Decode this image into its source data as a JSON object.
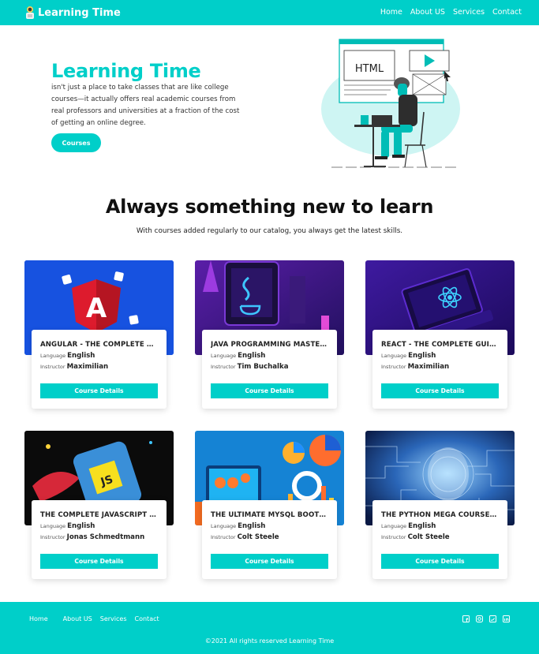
{
  "nav": {
    "brand": "Learning Time",
    "links": [
      "Home",
      "About US",
      "Services",
      "Contact"
    ]
  },
  "hero": {
    "title": "Learning Time",
    "text": "isn't just a place to take classes that are like college courses—it actually offers real academic courses from real professors and universities at a fraction of the cost of getting an online degree.",
    "button": "Courses",
    "illustration_label": "HTML"
  },
  "section": {
    "title": "Always something new to learn",
    "subtitle": "With courses added regularly to our catalog, you always get the latest skills."
  },
  "labels": {
    "language": "Language",
    "instructor": "Instructor",
    "details_button": "Course Details"
  },
  "courses": [
    {
      "name": "ANGULAR - THE COMPLETE GUI...",
      "language": "English",
      "instructor": "Maximilian",
      "image": "angular-logo"
    },
    {
      "name": "JAVA PROGRAMMING MASTERC...",
      "language": "English",
      "instructor": "Tim Buchalka",
      "image": "java-laptop"
    },
    {
      "name": "REACT - THE COMPLETE GUIDE (...",
      "language": "English",
      "instructor": "Maximilian",
      "image": "react-laptop"
    },
    {
      "name": "THE COMPLETE JAVASCRIPT CO...",
      "language": "English",
      "instructor": "Jonas Schmedtmann",
      "image": "javascript-mug"
    },
    {
      "name": "THE ULTIMATE MYSQL BOOTCA...",
      "language": "English",
      "instructor": "Colt Steele",
      "image": "mysql-dashboard"
    },
    {
      "name": "THE PYTHON MEGA COURSE: B...",
      "language": "English",
      "instructor": "Colt Steele",
      "image": "python-ai-head"
    }
  ],
  "footer": {
    "links": [
      "Home",
      "About US",
      "Services",
      "Contact"
    ],
    "social_icons": [
      "facebook-icon",
      "instagram-icon",
      "twitter-icon",
      "linkedin-icon"
    ],
    "copyright": "©2021 All rights reserved Learning Time"
  },
  "colors": {
    "accent": "#00cfc9",
    "text_dark": "#111111"
  }
}
